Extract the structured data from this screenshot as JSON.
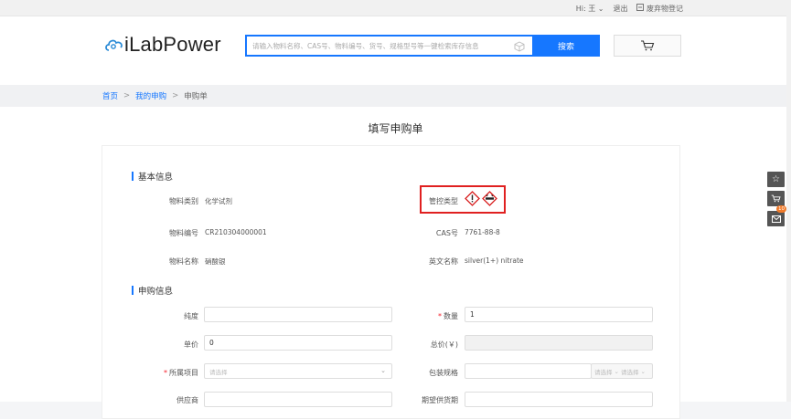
{
  "topbar": {
    "greeting": "Hi:",
    "user": "王",
    "logout": "退出",
    "waste": "废弃物登记"
  },
  "header": {
    "logo": "iLabPower",
    "search_placeholder": "请输入物料名称、CAS号、物料编号、货号、规格型号等一键检索库存信息",
    "search_button": "搜索"
  },
  "breadcrumb": {
    "home": "首页",
    "my": "我的申购",
    "current": "申购单",
    "sep": ">"
  },
  "page": {
    "title": "填写申购单"
  },
  "basic": {
    "title": "基本信息",
    "category_label": "物料类别",
    "category_value": "化学试剂",
    "control_label": "管控类型",
    "code_label": "物料编号",
    "code_value": "CR210304000001",
    "cas_label": "CAS号",
    "cas_value": "7761-88-8",
    "name_label": "物料名称",
    "name_value": "硝酸银",
    "en_label": "英文名称",
    "en_value": "silver(1+) nitrate"
  },
  "purchase": {
    "title": "申购信息",
    "purity_label": "纯度",
    "purity_value": "",
    "qty_label": "数量",
    "qty_value": "1",
    "price_label": "单价",
    "price_value": "0",
    "total_label": "总价(￥)",
    "total_value": "",
    "project_label": "所属项目",
    "project_placeholder": "请选择",
    "pack_label": "包装规格",
    "pack_sel1": "请选择",
    "pack_sel2": "请选择",
    "supplier_label": "供应商",
    "expected_label": "期望供货期"
  },
  "side": {
    "cart_count": "10"
  },
  "colors": {
    "accent": "#1677ff",
    "highlight": "#e02020"
  }
}
